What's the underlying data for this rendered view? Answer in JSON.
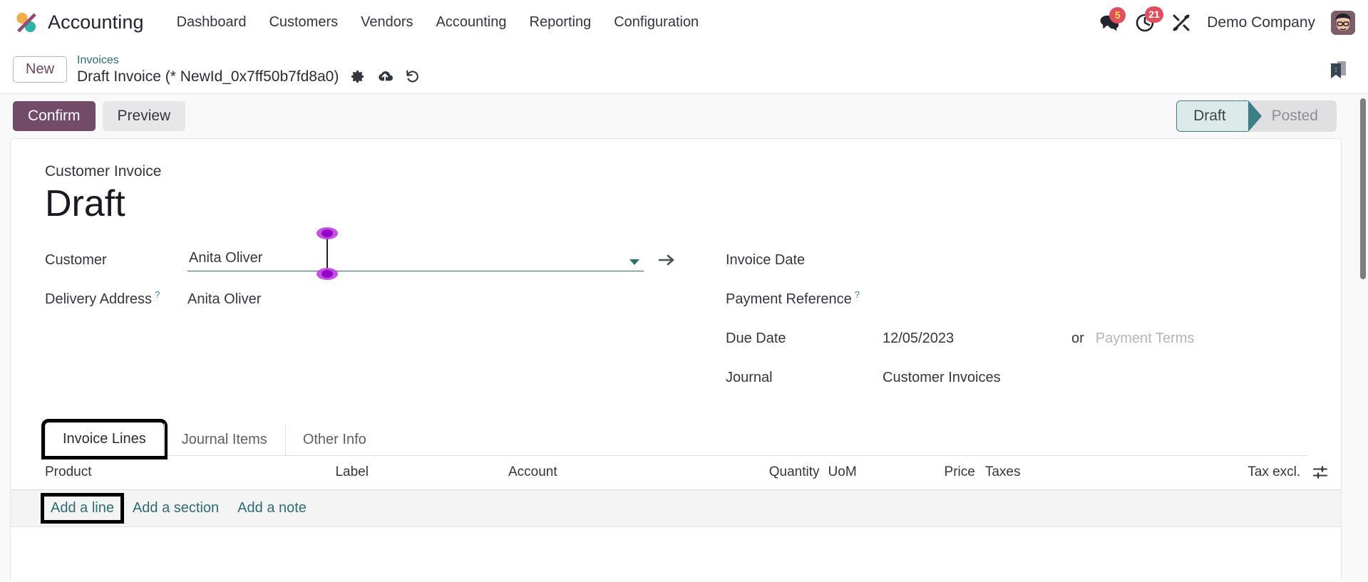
{
  "navbar": {
    "brand": "Accounting",
    "logo_icon": "odoo-accounting-logo",
    "menu": [
      {
        "label": "Dashboard"
      },
      {
        "label": "Customers"
      },
      {
        "label": "Vendors"
      },
      {
        "label": "Accounting"
      },
      {
        "label": "Reporting"
      },
      {
        "label": "Configuration"
      }
    ],
    "messages_icon": "chat-bubbles-icon",
    "messages_count": "5",
    "activities_icon": "clock-icon",
    "activities_count": "21",
    "debug_icon": "tools-bug-icon",
    "company": "Demo Company",
    "avatar_icon": "user-avatar"
  },
  "breadcrumb": {
    "new_button": "New",
    "parent": "Invoices",
    "current": "Draft Invoice (* NewId_0x7ff50b7fd8a0)",
    "settings_icon": "gear-icon",
    "save_icon": "cloud-upload-icon",
    "discard_icon": "undo-icon",
    "bookmark_icon": "bookmark-icon"
  },
  "actions": {
    "confirm": "Confirm",
    "preview": "Preview"
  },
  "statusbar": {
    "stages": [
      {
        "label": "Draft",
        "state": "active"
      },
      {
        "label": "Posted",
        "state": "pending"
      }
    ]
  },
  "form": {
    "doc_type": "Customer Invoice",
    "title": "Draft",
    "left": {
      "customer_label": "Customer",
      "customer_value": "Anita Oliver",
      "customer_dropdown_icon": "caret-down-icon",
      "customer_internal_link_icon": "arrow-right-icon",
      "delivery_label": "Delivery Address",
      "delivery_help": "?",
      "delivery_value": "Anita Oliver"
    },
    "right": {
      "invoice_date_label": "Invoice Date",
      "invoice_date_value": "",
      "payment_reference_label": "Payment Reference",
      "payment_reference_help": "?",
      "payment_reference_value": "",
      "due_date_label": "Due Date",
      "due_date_value": "12/05/2023",
      "or_word": "or",
      "payment_terms_placeholder": "Payment Terms",
      "journal_label": "Journal",
      "journal_value": "Customer Invoices"
    }
  },
  "notebook": {
    "tabs": [
      {
        "label": "Invoice Lines",
        "active": true,
        "annotated": true
      },
      {
        "label": "Journal Items",
        "active": false,
        "annotated": false
      },
      {
        "label": "Other Info",
        "active": false,
        "annotated": false
      }
    ]
  },
  "lines_table": {
    "columns": [
      "Product",
      "Label",
      "Account",
      "Quantity",
      "UoM",
      "Price",
      "Taxes",
      "Tax excl."
    ],
    "optional_columns_icon": "sliders-icon",
    "rows": [],
    "add_line": "Add a line",
    "add_section": "Add a section",
    "add_note": "Add a note"
  },
  "colors": {
    "brand_purple": "#714b67",
    "accent_teal": "#2f6b72",
    "badge_red": "#e04f5f",
    "status_active_bg": "#dcebe9",
    "annotation_black": "#000000",
    "selection_handle": "#9400c8"
  }
}
